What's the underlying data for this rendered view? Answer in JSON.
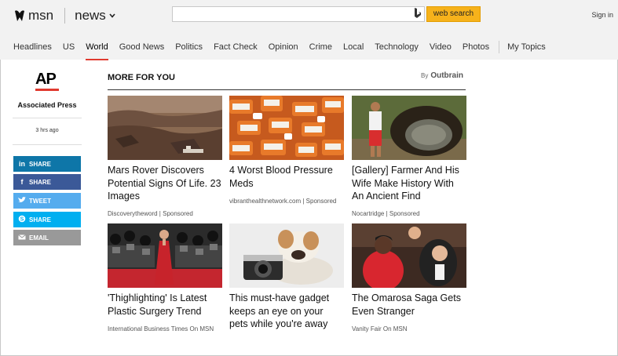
{
  "header": {
    "brand": "msn",
    "section": "news",
    "search_placeholder": "",
    "search_button": "web search",
    "sign_in": "Sign in"
  },
  "nav": {
    "items": [
      "Headlines",
      "US",
      "World",
      "Good News",
      "Politics",
      "Fact Check",
      "Opinion",
      "Crime",
      "Local",
      "Technology",
      "Video",
      "Photos"
    ],
    "active": "World",
    "my_topics": "My Topics"
  },
  "source": {
    "logo": "AP",
    "name": "Associated Press",
    "time": "3 hrs ago"
  },
  "share": [
    {
      "label": "SHARE",
      "icon": "linkedin-icon",
      "color": "#0e76a8"
    },
    {
      "label": "SHARE",
      "icon": "facebook-icon",
      "color": "#3b5998"
    },
    {
      "label": "TWEET",
      "icon": "twitter-icon",
      "color": "#55acee"
    },
    {
      "label": "SHARE",
      "icon": "skype-icon",
      "color": "#00aff0"
    },
    {
      "label": "EMAIL",
      "icon": "email-icon",
      "color": "#999999"
    }
  ],
  "more": {
    "heading": "MORE FOR YOU",
    "by": "By",
    "provider": "Outbrain"
  },
  "cards": [
    {
      "title": "Mars Rover Discovers Potential Signs Of Life. 23 Images",
      "meta": "Discoverytheword | Sponsored"
    },
    {
      "title": "4 Worst Blood Pressure Meds",
      "meta": "vibranthealthnetwork.com | Sponsored"
    },
    {
      "title": "[Gallery] Farmer And His Wife Make History With An Ancient Find",
      "meta": "Nocartridge | Sponsored"
    },
    {
      "title": "'Thighlighting' Is Latest Plastic Surgery Trend",
      "meta": "International Business Times On MSN"
    },
    {
      "title": "This must-have gadget keeps an eye on your pets while you're away",
      "meta": ""
    },
    {
      "title": "The Omarosa Saga Gets Even Stranger",
      "meta": "Vanity Fair On MSN"
    }
  ],
  "colors": {
    "accent": "#e03a2f",
    "search_button": "#f6b21b"
  }
}
